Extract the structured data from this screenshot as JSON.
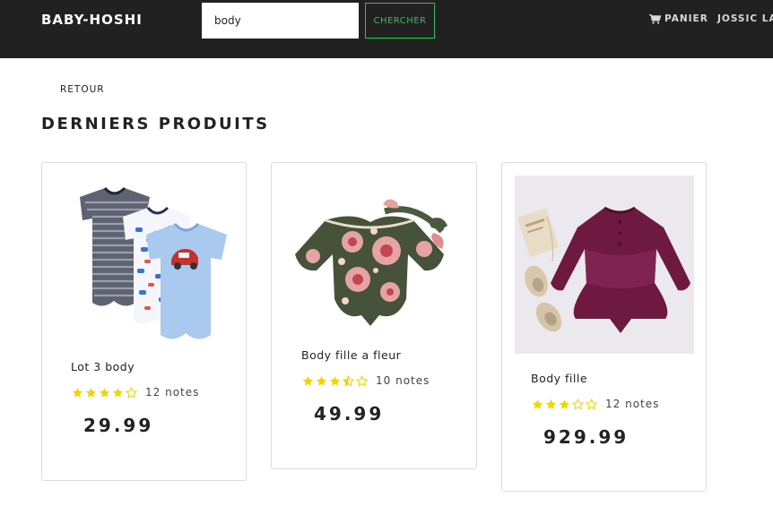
{
  "navbar": {
    "brand": "BABY-HOSHI",
    "search_value": "body",
    "search_button": "CHERCHER",
    "cart_label": "PANIER",
    "user_label": "JOSSIC LA"
  },
  "back_label": "RETOUR",
  "section_title": "DERNIERS PRODUITS",
  "colors": {
    "navbar": "#212121",
    "accent": "#2fbf5f",
    "star": "#f5d300"
  },
  "products": [
    {
      "name": "Lot 3 body",
      "rating": 4,
      "rating_count": "12 notes",
      "price": "29.99",
      "icon": "baby-bodysuits-set"
    },
    {
      "name": "Body fille a fleur",
      "rating": 3.5,
      "rating_count": "10 notes",
      "price": "49.99",
      "icon": "floral-bodysuit-headband"
    },
    {
      "name": "Body fille",
      "rating": 3,
      "rating_count": "12 notes",
      "price": "929.99",
      "icon": "purple-romper-photo"
    }
  ]
}
